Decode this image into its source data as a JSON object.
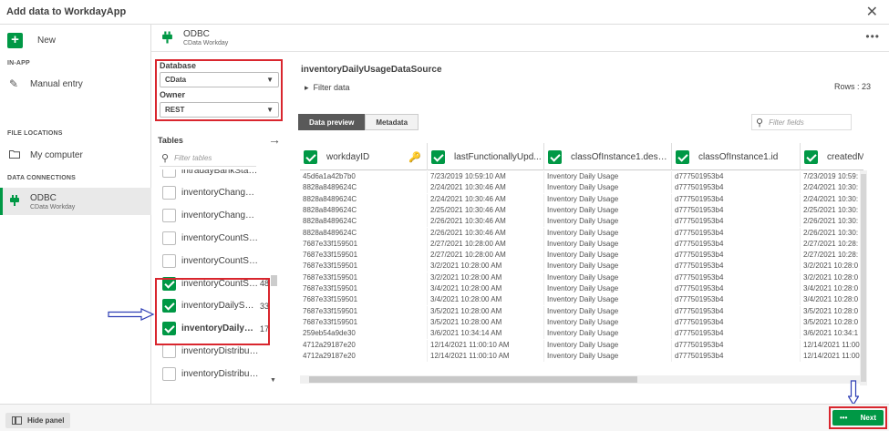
{
  "window": {
    "title": "Add data to WorkdayApp",
    "close_icon": "close-icon"
  },
  "sidebar": {
    "new_label": "New",
    "in_app_heading": "IN-APP",
    "manual_entry": "Manual entry",
    "file_locations_heading": "FILE LOCATIONS",
    "my_computer": "My computer",
    "data_connections_heading": "DATA CONNECTIONS",
    "connection": {
      "name": "ODBC",
      "sub": "CData Workday"
    }
  },
  "connection_header": {
    "name": "ODBC",
    "sub": "CData Workday",
    "more": "•••"
  },
  "database": {
    "label": "Database",
    "value": "CData"
  },
  "owner": {
    "label": "Owner",
    "value": "REST"
  },
  "tables": {
    "heading": "Tables",
    "filter_placeholder": "Filter tables",
    "items": [
      {
        "name": "intradayBankState...",
        "count": "",
        "checked": false,
        "bold": false
      },
      {
        "name": "inventoryChangeB...",
        "count": "",
        "checked": false,
        "bold": false
      },
      {
        "name": "inventoryChangeB...",
        "count": "",
        "checked": false,
        "bold": false
      },
      {
        "name": "inventoryCountSheet",
        "count": "",
        "checked": false,
        "bold": false
      },
      {
        "name": "inventoryCountShe...",
        "count": "",
        "checked": false,
        "bold": false
      },
      {
        "name": "inventoryCountShe...",
        "count": "48",
        "checked": true,
        "bold": false
      },
      {
        "name": "inventoryDailySna...",
        "count": "33",
        "checked": true,
        "bold": false
      },
      {
        "name": "inventoryDailyUs...",
        "count": "17",
        "checked": true,
        "bold": true
      },
      {
        "name": "inventoryDistributi...",
        "count": "",
        "checked": false,
        "bold": false
      },
      {
        "name": "inventoryDistributi...",
        "count": "",
        "checked": false,
        "bold": false
      }
    ]
  },
  "preview": {
    "datasource": "inventoryDailyUsageDataSource",
    "filter_data": "Filter data",
    "rows": "Rows : 23",
    "tab_preview": "Data preview",
    "tab_metadata": "Metadata",
    "filter_fields_placeholder": "Filter fields",
    "columns": [
      "workdayID",
      "lastFunctionallyUpd...",
      "classOfInstance1.descri...",
      "classOfInstance1.id",
      "createdMo"
    ],
    "rows_data": [
      [
        "45d6a1a42b7b0",
        "7/23/2019 10:59:10 AM",
        "Inventory Daily Usage",
        "d777501953b4",
        "7/23/2019 10:59:"
      ],
      [
        "8828a8489624C",
        "2/24/2021 10:30:46 AM",
        "Inventory Daily Usage",
        "d777501953b4",
        "2/24/2021 10:30:"
      ],
      [
        "8828a8489624C",
        "2/24/2021 10:30:46 AM",
        "Inventory Daily Usage",
        "d777501953b4",
        "2/24/2021 10:30:"
      ],
      [
        "8828a8489624C",
        "2/25/2021 10:30:46 AM",
        "Inventory Daily Usage",
        "d777501953b4",
        "2/25/2021 10:30:"
      ],
      [
        "8828a8489624C",
        "2/26/2021 10:30:46 AM",
        "Inventory Daily Usage",
        "d777501953b4",
        "2/26/2021 10:30:"
      ],
      [
        "8828a8489624C",
        "2/26/2021 10:30:46 AM",
        "Inventory Daily Usage",
        "d777501953b4",
        "2/26/2021 10:30:"
      ],
      [
        "7687e33f159501",
        "2/27/2021 10:28:00 AM",
        "Inventory Daily Usage",
        "d777501953b4",
        "2/27/2021 10:28:"
      ],
      [
        "7687e33f159501",
        "2/27/2021 10:28:00 AM",
        "Inventory Daily Usage",
        "d777501953b4",
        "2/27/2021 10:28:"
      ],
      [
        "7687e33f159501",
        "3/2/2021 10:28:00 AM",
        "Inventory Daily Usage",
        "d777501953b4",
        "3/2/2021 10:28:0"
      ],
      [
        "7687e33f159501",
        "3/2/2021 10:28:00 AM",
        "Inventory Daily Usage",
        "d777501953b4",
        "3/2/2021 10:28:0"
      ],
      [
        "7687e33f159501",
        "3/4/2021 10:28:00 AM",
        "Inventory Daily Usage",
        "d777501953b4",
        "3/4/2021 10:28:0"
      ],
      [
        "7687e33f159501",
        "3/4/2021 10:28:00 AM",
        "Inventory Daily Usage",
        "d777501953b4",
        "3/4/2021 10:28:0"
      ],
      [
        "7687e33f159501",
        "3/5/2021 10:28:00 AM",
        "Inventory Daily Usage",
        "d777501953b4",
        "3/5/2021 10:28:0"
      ],
      [
        "7687e33f159501",
        "3/5/2021 10:28:00 AM",
        "Inventory Daily Usage",
        "d777501953b4",
        "3/5/2021 10:28:0"
      ],
      [
        "259eb54a9de30",
        "3/6/2021 10:34:14 AM",
        "Inventory Daily Usage",
        "d777501953b4",
        "3/6/2021 10:34:1"
      ],
      [
        "4712a29187e20",
        "12/14/2021 11:00:10 AM",
        "Inventory Daily Usage",
        "d777501953b4",
        "12/14/2021 11:00"
      ],
      [
        "4712a29187e20",
        "12/14/2021 11:00:10 AM",
        "Inventory Daily Usage",
        "d777501953b4",
        "12/14/2021 11:00"
      ]
    ]
  },
  "footer": {
    "hide_panel": "Hide panel",
    "next": "Next",
    "next_dots": "•••"
  },
  "colors": {
    "accent": "#009845",
    "highlight": "#d9262e",
    "annotation_arrow": "#2f3fb5"
  }
}
